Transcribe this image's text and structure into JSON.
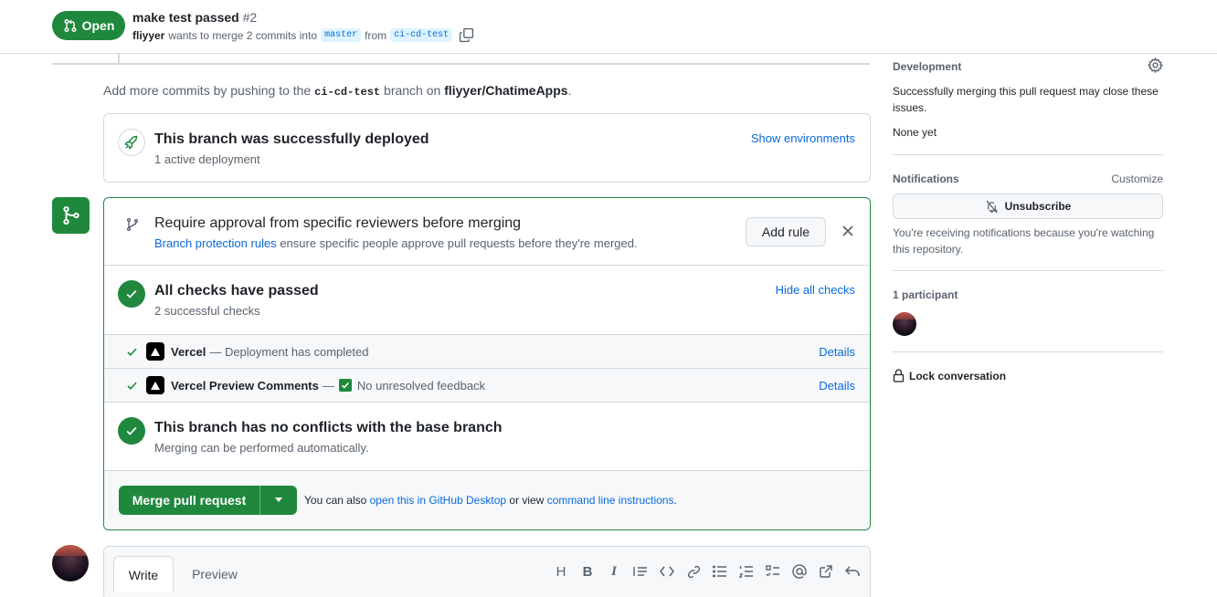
{
  "header": {
    "state_label": "Open",
    "title": "make test passed",
    "number": "#2",
    "author": "fliyyer",
    "merge_text": "wants to merge 2 commits into",
    "base_branch": "master",
    "from_text": "from",
    "head_branch": "ci-cd-test"
  },
  "hint": {
    "prefix": "Add more commits by pushing to the",
    "branch": "ci-cd-test",
    "middle": "branch on",
    "repo": "fliyyer/ChatimeApps",
    "suffix": "."
  },
  "deploy": {
    "title": "This branch was successfully deployed",
    "subtitle": "1 active deployment",
    "action": "Show environments"
  },
  "protection": {
    "title": "Require approval from specific reviewers before merging",
    "link": "Branch protection rules",
    "desc": "ensure specific people approve pull requests before they're merged.",
    "button": "Add rule"
  },
  "checks": {
    "title": "All checks have passed",
    "subtitle": "2 successful checks",
    "action": "Hide all checks",
    "items": [
      {
        "name": "Vercel",
        "status": "— Deployment has completed",
        "action": "Details"
      },
      {
        "name": "Vercel Preview Comments",
        "status_prefix": "—",
        "status": "No unresolved feedback",
        "action": "Details"
      }
    ]
  },
  "conflicts": {
    "title": "This branch has no conflicts with the base branch",
    "subtitle": "Merging can be performed automatically."
  },
  "merge": {
    "button": "Merge pull request",
    "text1": "You can also",
    "link1": "open this in GitHub Desktop",
    "text2": "or view",
    "link2": "command line instructions",
    "text3": "."
  },
  "comment": {
    "tab_write": "Write",
    "tab_preview": "Preview",
    "tools": [
      "heading-icon",
      "bold-icon",
      "italic-icon",
      "quote-icon",
      "code-icon",
      "link-icon",
      "unordered-list-icon",
      "ordered-list-icon",
      "task-list-icon",
      "mention-icon",
      "cross-reference-icon",
      "reply-icon"
    ]
  },
  "sidebar": {
    "development": {
      "title": "Development",
      "text": "Successfully merging this pull request may close these issues.",
      "none": "None yet"
    },
    "notifications": {
      "title": "Notifications",
      "customize": "Customize",
      "button": "Unsubscribe",
      "text": "You're receiving notifications because you're watching this repository."
    },
    "participants": {
      "title": "1 participant"
    },
    "lock": "Lock conversation"
  },
  "colors": {
    "success": "#1f883d",
    "link": "#0969da",
    "border": "#d1d9e0"
  }
}
